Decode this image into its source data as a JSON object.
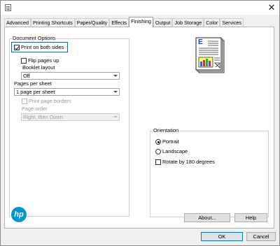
{
  "titlebar": {
    "close_glyph": "✕",
    "icon": "printer-icon"
  },
  "tabs": [
    {
      "label": "Advanced",
      "active": false
    },
    {
      "label": "Printing Shortcuts",
      "active": false
    },
    {
      "label": "Paper/Quality",
      "active": false
    },
    {
      "label": "Effects",
      "active": false
    },
    {
      "label": "Finishing",
      "active": true
    },
    {
      "label": "Output",
      "active": false
    },
    {
      "label": "Job Storage",
      "active": false
    },
    {
      "label": "Color",
      "active": false
    },
    {
      "label": "Services",
      "active": false
    }
  ],
  "document_options": {
    "title": "Document Options",
    "print_both_sides": {
      "label": "Print on both sides",
      "checked": true
    },
    "flip_pages_up": {
      "label": "Flip pages up",
      "checked": false
    },
    "booklet_layout": {
      "label": "Booklet layout",
      "value": "Off"
    },
    "pages_per_sheet": {
      "label": "Pages per sheet",
      "value": "1 page per sheet"
    },
    "print_page_borders": {
      "label": "Print page borders",
      "checked": false,
      "enabled": false
    },
    "page_order": {
      "label": "Page order",
      "value": "Right, then Down",
      "enabled": false
    }
  },
  "preview": {
    "letter": "E",
    "icon": "document-preview-icon"
  },
  "orientation": {
    "title": "Orientation",
    "options": [
      {
        "label": "Portrait",
        "selected": true
      },
      {
        "label": "Landscape",
        "selected": false
      }
    ],
    "rotate": {
      "label": "Rotate by 180 degrees",
      "checked": false
    }
  },
  "brand": {
    "logo_text": "hp",
    "color": "#0096d6"
  },
  "buttons": {
    "about": "About...",
    "help": "Help",
    "ok": "OK",
    "cancel": "Cancel"
  }
}
